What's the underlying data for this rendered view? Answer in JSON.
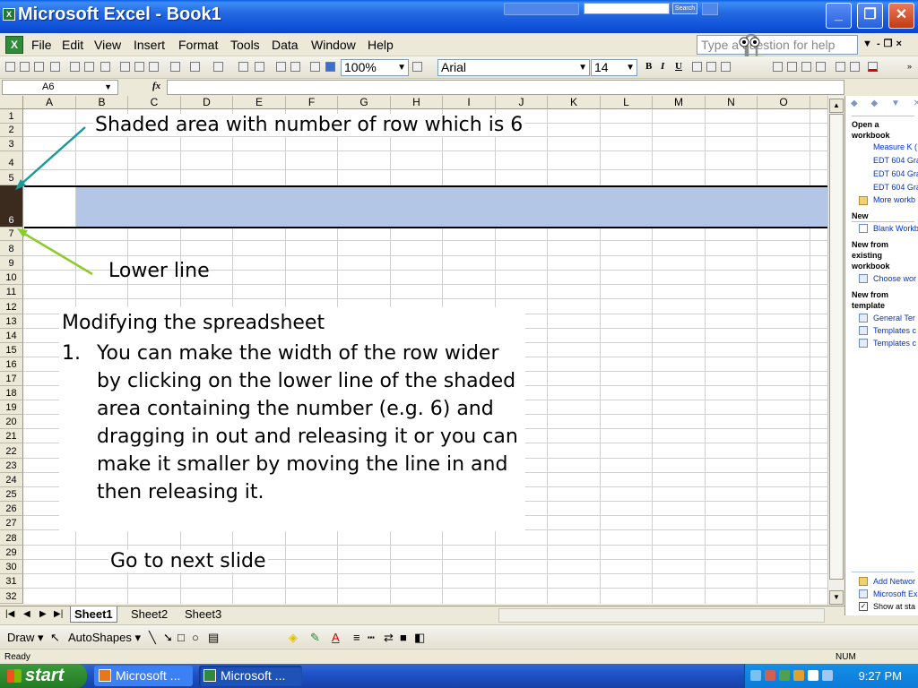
{
  "window": {
    "title": "Microsoft Excel - Book1",
    "app_icon": "excel-icon",
    "search_label": "Search",
    "controls": {
      "minimize": "_",
      "maximize": "❐",
      "close": "✕"
    }
  },
  "menu": {
    "items": [
      "File",
      "Edit",
      "View",
      "Insert",
      "Format",
      "Tools",
      "Data",
      "Window",
      "Help"
    ],
    "help_box_placeholder": "Type a question for help"
  },
  "toolbar": {
    "zoom": "100%",
    "font": "Arial",
    "font_size": "14",
    "bold": "B",
    "italic": "I",
    "underline": "U"
  },
  "formula_bar": {
    "name_box": "A6",
    "fx": "fx",
    "formula": ""
  },
  "grid": {
    "columns": [
      "A",
      "B",
      "C",
      "D",
      "E",
      "F",
      "G",
      "H",
      "I",
      "J",
      "K",
      "L",
      "M",
      "N",
      "O"
    ],
    "rows": [
      "1",
      "2",
      "3",
      "4",
      "5",
      "6",
      "7",
      "8",
      "9",
      "10",
      "11",
      "12",
      "13",
      "14",
      "15",
      "16",
      "17",
      "18",
      "19",
      "20",
      "21",
      "22",
      "23",
      "24",
      "25",
      "26",
      "27",
      "28",
      "29",
      "30",
      "31",
      "32"
    ],
    "selected_row": "6"
  },
  "annotations": {
    "shaded_label": "Shaded area with number of row which is 6",
    "lower_line_label": "Lower line",
    "instructions_title": "Modifying the spreadsheet",
    "instruction_number": "1.",
    "instruction_text": "You can make the width of the row wider by clicking on the lower line of the shaded area containing the number (e.g. 6) and dragging in out and releasing it or you can make it smaller by moving the line in and then releasing it.",
    "next_slide": "Go to next slide",
    "arrow_color_1": "#1a9a9a",
    "arrow_color_2": "#8ccc2a"
  },
  "task_pane": {
    "nav": "◆ ◆ ▼ ✕",
    "open_heading": "Open a workbook",
    "open_items": [
      "Measure K (",
      "EDT 604 Gra",
      "EDT 604 Gra",
      "EDT 604 Gra"
    ],
    "more_link": "More workb",
    "new_heading": "New",
    "new_item": "Blank Workb",
    "from_existing_heading": "New from existing workbook",
    "from_existing_item": "Choose wor",
    "from_template_heading": "New from template",
    "template_items": [
      "General Ter",
      "Templates c",
      "Templates c"
    ],
    "bottom_items": [
      "Add Networ",
      "Microsoft Ex"
    ],
    "show_at_startup": "Show at sta"
  },
  "sheets": {
    "tabs": [
      "Sheet1",
      "Sheet2",
      "Sheet3"
    ],
    "active": "Sheet1"
  },
  "draw_toolbar": {
    "draw": "Draw ▾",
    "autoshapes": "AutoShapes ▾"
  },
  "status": {
    "left": "Ready",
    "num": "NUM"
  },
  "taskbar": {
    "start": "start",
    "buttons": [
      "Microsoft ...",
      "Microsoft ..."
    ],
    "clock": "9:27 PM"
  },
  "colors": {
    "shade": "#b3c6e6",
    "selected_row_header": "#3b2a1e",
    "titlebar": "#0d50d8"
  }
}
